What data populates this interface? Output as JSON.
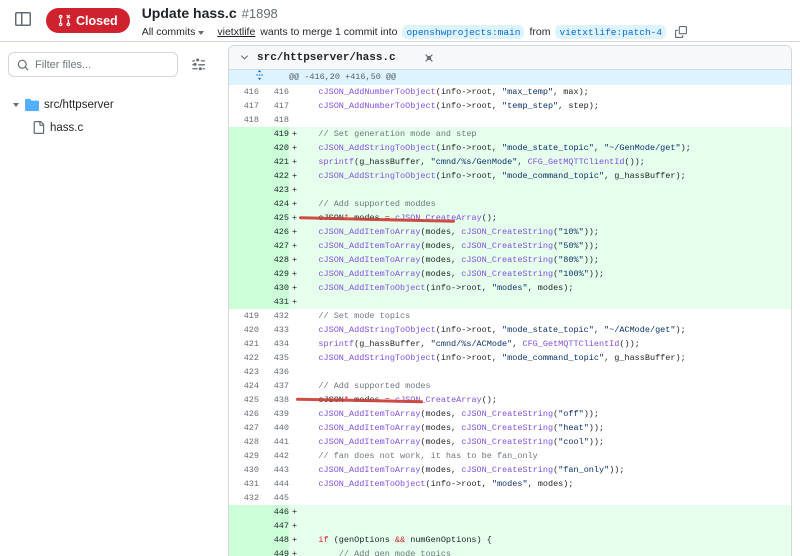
{
  "colors": {
    "closed_badge": "#cf222e",
    "add_line_bg": "#e6ffec",
    "add_gutter_bg": "#ccffd8",
    "hunk_bg": "#ddf4ff",
    "branch_label_fg": "#0969da",
    "branch_label_bg": "#ddf4ff",
    "annotation_red": "#cb3a33"
  },
  "icons": {
    "sidebar_collapse": "panel-left",
    "pr_closed": "git-pull-request-closed",
    "dropdown": "caret-down",
    "copy": "two-overlapping-squares",
    "search": "magnifier",
    "filter": "sliders",
    "folder": "directory-fill-blue",
    "file": "file-outline",
    "chevron": "chevron-down",
    "unfold": "expand-up-down-arrows"
  },
  "header": {
    "status_label": "Closed",
    "title": "Update hass.c",
    "pr_number": "#1898",
    "commits_dropdown_label": "All commits",
    "merge_text": {
      "author": "vietxtlife",
      "middle": "wants to merge 1 commit into",
      "base_branch": "openshwprojects:main",
      "from_word": "from",
      "head_branch": "vietxtlife:patch-4"
    }
  },
  "sidebar": {
    "filter_placeholder": "Filter files...",
    "tree": {
      "folder_label": "src/httpserver",
      "file_label": "hass.c"
    }
  },
  "diff": {
    "file_path": "src/httpserver/hass.c",
    "hunk_header": "@@ -416,20 +416,50 @@",
    "lines": [
      {
        "t": "ctx",
        "o": "416",
        "n": "416",
        "tk": [
          [
            "p",
            "    "
          ],
          [
            "f",
            "cJSON_AddNumberToObject"
          ],
          [
            "p",
            "(info->root, "
          ],
          [
            "s",
            "\"max_temp\""
          ],
          [
            "p",
            ", max);"
          ]
        ]
      },
      {
        "t": "ctx",
        "o": "417",
        "n": "417",
        "tk": [
          [
            "p",
            "    "
          ],
          [
            "f",
            "cJSON_AddNumberToObject"
          ],
          [
            "p",
            "(info->root, "
          ],
          [
            "s",
            "\"temp_step\""
          ],
          [
            "p",
            ", step);"
          ]
        ]
      },
      {
        "t": "ctx",
        "o": "418",
        "n": "418",
        "tk": []
      },
      {
        "t": "add",
        "o": "",
        "n": "419",
        "tk": [
          [
            "p",
            "    "
          ],
          [
            "c",
            "// Set generation mode and step"
          ]
        ]
      },
      {
        "t": "add",
        "o": "",
        "n": "420",
        "tk": [
          [
            "p",
            "    "
          ],
          [
            "f",
            "cJSON_AddStringToObject"
          ],
          [
            "p",
            "(info->root, "
          ],
          [
            "s",
            "\"mode_state_topic\""
          ],
          [
            "p",
            ", "
          ],
          [
            "s",
            "\"~/GenMode/get\""
          ],
          [
            "p",
            ");"
          ]
        ]
      },
      {
        "t": "add",
        "o": "",
        "n": "421",
        "tk": [
          [
            "p",
            "    "
          ],
          [
            "f",
            "sprintf"
          ],
          [
            "p",
            "(g_hassBuffer, "
          ],
          [
            "s",
            "\"cmnd/%s/GenMode\""
          ],
          [
            "p",
            ", "
          ],
          [
            "f",
            "CFG_GetMQTTClientId"
          ],
          [
            "p",
            "());"
          ]
        ]
      },
      {
        "t": "add",
        "o": "",
        "n": "422",
        "tk": [
          [
            "p",
            "    "
          ],
          [
            "f",
            "cJSON_AddStringToObject"
          ],
          [
            "p",
            "(info->root, "
          ],
          [
            "s",
            "\"mode_command_topic\""
          ],
          [
            "p",
            ", g_hassBuffer);"
          ]
        ]
      },
      {
        "t": "add",
        "o": "",
        "n": "423",
        "tk": []
      },
      {
        "t": "add",
        "o": "",
        "n": "424",
        "tk": [
          [
            "p",
            "    "
          ],
          [
            "c",
            "// Add supported moddes"
          ]
        ]
      },
      {
        "t": "add",
        "o": "",
        "n": "425",
        "tk": [
          [
            "p",
            "    cJSON"
          ],
          [
            "k",
            "*"
          ],
          [
            "p",
            " modes "
          ],
          [
            "k",
            "="
          ],
          [
            "p",
            " "
          ],
          [
            "f",
            "cJSON_CreateArray"
          ],
          [
            "p",
            "();"
          ]
        ]
      },
      {
        "t": "add",
        "o": "",
        "n": "426",
        "tk": [
          [
            "p",
            "    "
          ],
          [
            "f",
            "cJSON_AddItemToArray"
          ],
          [
            "p",
            "(modes, "
          ],
          [
            "f",
            "cJSON_CreateString"
          ],
          [
            "p",
            "("
          ],
          [
            "s",
            "\"10%\""
          ],
          [
            "p",
            "));"
          ]
        ]
      },
      {
        "t": "add",
        "o": "",
        "n": "427",
        "tk": [
          [
            "p",
            "    "
          ],
          [
            "f",
            "cJSON_AddItemToArray"
          ],
          [
            "p",
            "(modes, "
          ],
          [
            "f",
            "cJSON_CreateString"
          ],
          [
            "p",
            "("
          ],
          [
            "s",
            "\"50%\""
          ],
          [
            "p",
            "));"
          ]
        ]
      },
      {
        "t": "add",
        "o": "",
        "n": "428",
        "tk": [
          [
            "p",
            "    "
          ],
          [
            "f",
            "cJSON_AddItemToArray"
          ],
          [
            "p",
            "(modes, "
          ],
          [
            "f",
            "cJSON_CreateString"
          ],
          [
            "p",
            "("
          ],
          [
            "s",
            "\"80%\""
          ],
          [
            "p",
            "));"
          ]
        ]
      },
      {
        "t": "add",
        "o": "",
        "n": "429",
        "tk": [
          [
            "p",
            "    "
          ],
          [
            "f",
            "cJSON_AddItemToArray"
          ],
          [
            "p",
            "(modes, "
          ],
          [
            "f",
            "cJSON_CreateString"
          ],
          [
            "p",
            "("
          ],
          [
            "s",
            "\"100%\""
          ],
          [
            "p",
            "));"
          ]
        ]
      },
      {
        "t": "add",
        "o": "",
        "n": "430",
        "tk": [
          [
            "p",
            "    "
          ],
          [
            "f",
            "cJSON_AddItemToObject"
          ],
          [
            "p",
            "(info->root, "
          ],
          [
            "s",
            "\"modes\""
          ],
          [
            "p",
            ", modes);"
          ]
        ]
      },
      {
        "t": "add",
        "o": "",
        "n": "431",
        "tk": []
      },
      {
        "t": "ctx",
        "o": "419",
        "n": "432",
        "tk": [
          [
            "p",
            "    "
          ],
          [
            "c",
            "// Set mode topics"
          ]
        ]
      },
      {
        "t": "ctx",
        "o": "420",
        "n": "433",
        "tk": [
          [
            "p",
            "    "
          ],
          [
            "f",
            "cJSON_AddStringToObject"
          ],
          [
            "p",
            "(info->root, "
          ],
          [
            "s",
            "\"mode_state_topic\""
          ],
          [
            "p",
            ", "
          ],
          [
            "s",
            "\"~/ACMode/get\""
          ],
          [
            "p",
            ");"
          ]
        ]
      },
      {
        "t": "ctx",
        "o": "421",
        "n": "434",
        "tk": [
          [
            "p",
            "    "
          ],
          [
            "f",
            "sprintf"
          ],
          [
            "p",
            "(g_hassBuffer, "
          ],
          [
            "s",
            "\"cmnd/%s/ACMode\""
          ],
          [
            "p",
            ", "
          ],
          [
            "f",
            "CFG_GetMQTTClientId"
          ],
          [
            "p",
            "());"
          ]
        ]
      },
      {
        "t": "ctx",
        "o": "422",
        "n": "435",
        "tk": [
          [
            "p",
            "    "
          ],
          [
            "f",
            "cJSON_AddStringToObject"
          ],
          [
            "p",
            "(info->root, "
          ],
          [
            "s",
            "\"mode_command_topic\""
          ],
          [
            "p",
            ", g_hassBuffer);"
          ]
        ]
      },
      {
        "t": "ctx",
        "o": "423",
        "n": "436",
        "tk": []
      },
      {
        "t": "ctx",
        "o": "424",
        "n": "437",
        "tk": [
          [
            "p",
            "    "
          ],
          [
            "c",
            "// Add supported modes"
          ]
        ]
      },
      {
        "t": "ctx",
        "o": "425",
        "n": "438",
        "tk": [
          [
            "p",
            "    cJSON"
          ],
          [
            "k",
            "*"
          ],
          [
            "p",
            " modes "
          ],
          [
            "k",
            "="
          ],
          [
            "p",
            " "
          ],
          [
            "f",
            "cJSON_CreateArray"
          ],
          [
            "p",
            "();"
          ]
        ]
      },
      {
        "t": "ctx",
        "o": "426",
        "n": "439",
        "tk": [
          [
            "p",
            "    "
          ],
          [
            "f",
            "cJSON_AddItemToArray"
          ],
          [
            "p",
            "(modes, "
          ],
          [
            "f",
            "cJSON_CreateString"
          ],
          [
            "p",
            "("
          ],
          [
            "s",
            "\"off\""
          ],
          [
            "p",
            "));"
          ]
        ]
      },
      {
        "t": "ctx",
        "o": "427",
        "n": "440",
        "tk": [
          [
            "p",
            "    "
          ],
          [
            "f",
            "cJSON_AddItemToArray"
          ],
          [
            "p",
            "(modes, "
          ],
          [
            "f",
            "cJSON_CreateString"
          ],
          [
            "p",
            "("
          ],
          [
            "s",
            "\"heat\""
          ],
          [
            "p",
            "));"
          ]
        ]
      },
      {
        "t": "ctx",
        "o": "428",
        "n": "441",
        "tk": [
          [
            "p",
            "    "
          ],
          [
            "f",
            "cJSON_AddItemToArray"
          ],
          [
            "p",
            "(modes, "
          ],
          [
            "f",
            "cJSON_CreateString"
          ],
          [
            "p",
            "("
          ],
          [
            "s",
            "\"cool\""
          ],
          [
            "p",
            "));"
          ]
        ]
      },
      {
        "t": "ctx",
        "o": "429",
        "n": "442",
        "tk": [
          [
            "p",
            "    "
          ],
          [
            "c",
            "// fan does not work, it has to be fan_only"
          ]
        ]
      },
      {
        "t": "ctx",
        "o": "430",
        "n": "443",
        "tk": [
          [
            "p",
            "    "
          ],
          [
            "f",
            "cJSON_AddItemToArray"
          ],
          [
            "p",
            "(modes, "
          ],
          [
            "f",
            "cJSON_CreateString"
          ],
          [
            "p",
            "("
          ],
          [
            "s",
            "\"fan_only\""
          ],
          [
            "p",
            "));"
          ]
        ]
      },
      {
        "t": "ctx",
        "o": "431",
        "n": "444",
        "tk": [
          [
            "p",
            "    "
          ],
          [
            "f",
            "cJSON_AddItemToObject"
          ],
          [
            "p",
            "(info->root, "
          ],
          [
            "s",
            "\"modes\""
          ],
          [
            "p",
            ", modes);"
          ]
        ]
      },
      {
        "t": "ctx",
        "o": "432",
        "n": "445",
        "tk": []
      },
      {
        "t": "add",
        "o": "",
        "n": "446",
        "tk": []
      },
      {
        "t": "add",
        "o": "",
        "n": "447",
        "tk": []
      },
      {
        "t": "add",
        "o": "",
        "n": "448",
        "tk": [
          [
            "p",
            "    "
          ],
          [
            "k",
            "if"
          ],
          [
            "p",
            " (genOptions "
          ],
          [
            "k",
            "&&"
          ],
          [
            "p",
            " numGenOptions) {"
          ]
        ]
      },
      {
        "t": "add",
        "o": "",
        "n": "449",
        "tk": [
          [
            "p",
            "        "
          ],
          [
            "c",
            "// Add gen mode topics"
          ]
        ]
      }
    ]
  }
}
